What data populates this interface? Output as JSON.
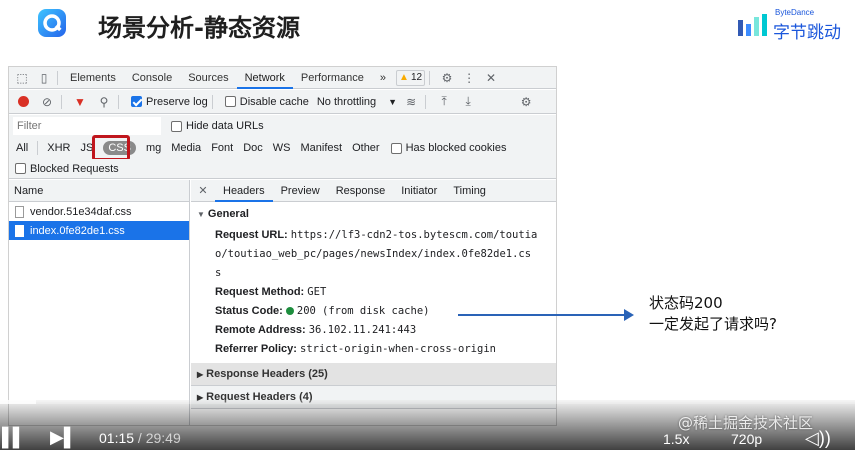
{
  "slide": {
    "title": "场景分析-静态资源",
    "brand_small": "ByteDance",
    "brand_large": "字节跳动"
  },
  "devtools": {
    "tabs": [
      "Elements",
      "Console",
      "Sources",
      "Network",
      "Performance"
    ],
    "active_tab": "Network",
    "more": "»",
    "warning_count": "12",
    "toolbar": {
      "preserve_log": "Preserve log",
      "disable_cache": "Disable cache",
      "throttling": "No throttling"
    },
    "filter": {
      "placeholder": "Filter",
      "hide_data_urls": "Hide data URLs"
    },
    "types": [
      "All",
      "XHR",
      "JS",
      "CSS",
      "Img",
      "Media",
      "Font",
      "Doc",
      "WS",
      "Manifest",
      "Other"
    ],
    "types_display": {
      "all": "All",
      "xhr": "XHR",
      "js": "JS",
      "css": "CSS",
      "img": "mg",
      "media": "Media",
      "font": "Font",
      "doc": "Doc",
      "ws": "WS",
      "manifest": "Manifest",
      "other": "Other"
    },
    "has_blocked_cookies": "Has blocked cookies",
    "blocked_requests": "Blocked Requests",
    "name_header": "Name",
    "files": [
      "vendor.51e34daf.css",
      "index.0fe82de1.css"
    ],
    "detail_tabs": [
      "Headers",
      "Preview",
      "Response",
      "Initiator",
      "Timing"
    ],
    "general": {
      "heading": "General",
      "request_url_label": "Request URL:",
      "request_url_1": "https://lf3-cdn2-tos.bytescm.com/toutia",
      "request_url_2": "o/toutiao_web_pc/pages/newsIndex/index.0fe82de1.cs",
      "request_url_3": "s",
      "method_label": "Request Method:",
      "method": "GET",
      "status_label": "Status Code:",
      "status": "200",
      "status_note": "(from disk cache)",
      "remote_label": "Remote Address:",
      "remote": "36.102.11.241:443",
      "referrer_label": "Referrer Policy:",
      "referrer": "strict-origin-when-cross-origin"
    },
    "response_headers": "Response Headers (25)",
    "request_headers": "Request Headers (4)"
  },
  "annotation": {
    "line1": "状态码200",
    "line2": "一定发起了请求吗?"
  },
  "player": {
    "current": "01:15",
    "separator": " / ",
    "duration": "29:49",
    "progress": 0.042,
    "speed": "1.5x",
    "quality": "720p",
    "watermark": "@稀土掘金技术社区"
  }
}
